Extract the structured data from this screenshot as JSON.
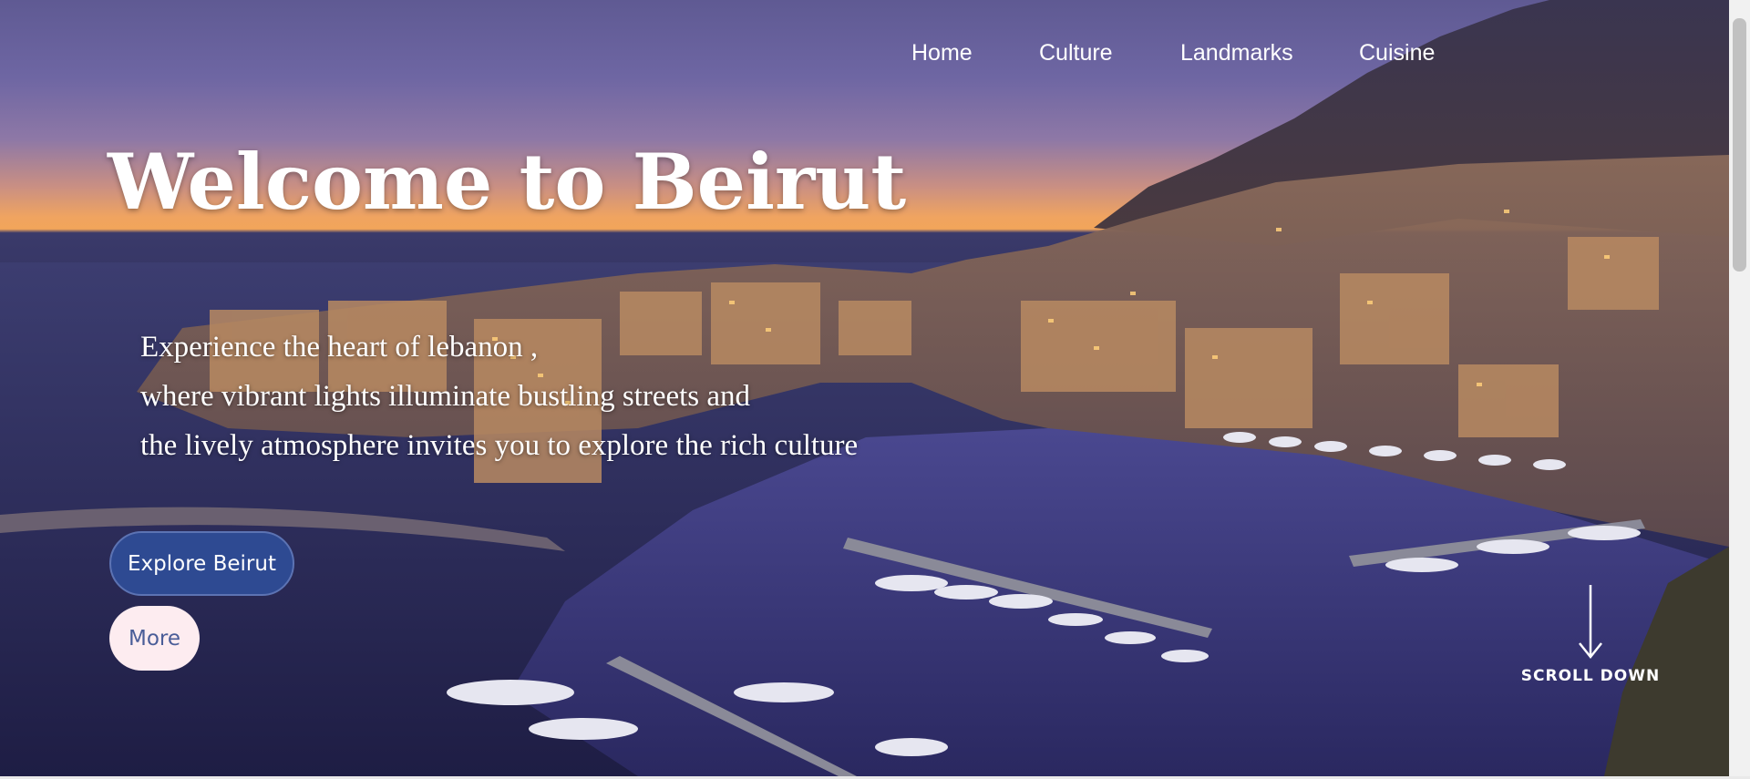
{
  "nav": {
    "items": [
      "Home",
      "Culture",
      "Landmarks",
      "Cuisine"
    ]
  },
  "hero": {
    "title": "Welcome to Beirut",
    "lines": [
      "Experience the heart of lebanon ,",
      "where vibrant lights illuminate bustling streets and",
      "the lively atmosphere invites you to explore the rich culture"
    ],
    "primary_button": "Explore Beirut",
    "secondary_button": "More",
    "scroll_label": "SCROLL DOWN"
  },
  "icons": {
    "scroll": "arrow-down-icon"
  },
  "colors": {
    "primary_button_bg": "#2e4a92",
    "secondary_button_bg": "#fdecf0",
    "secondary_button_text": "#4a5d98",
    "nav_text": "#ffffff"
  }
}
